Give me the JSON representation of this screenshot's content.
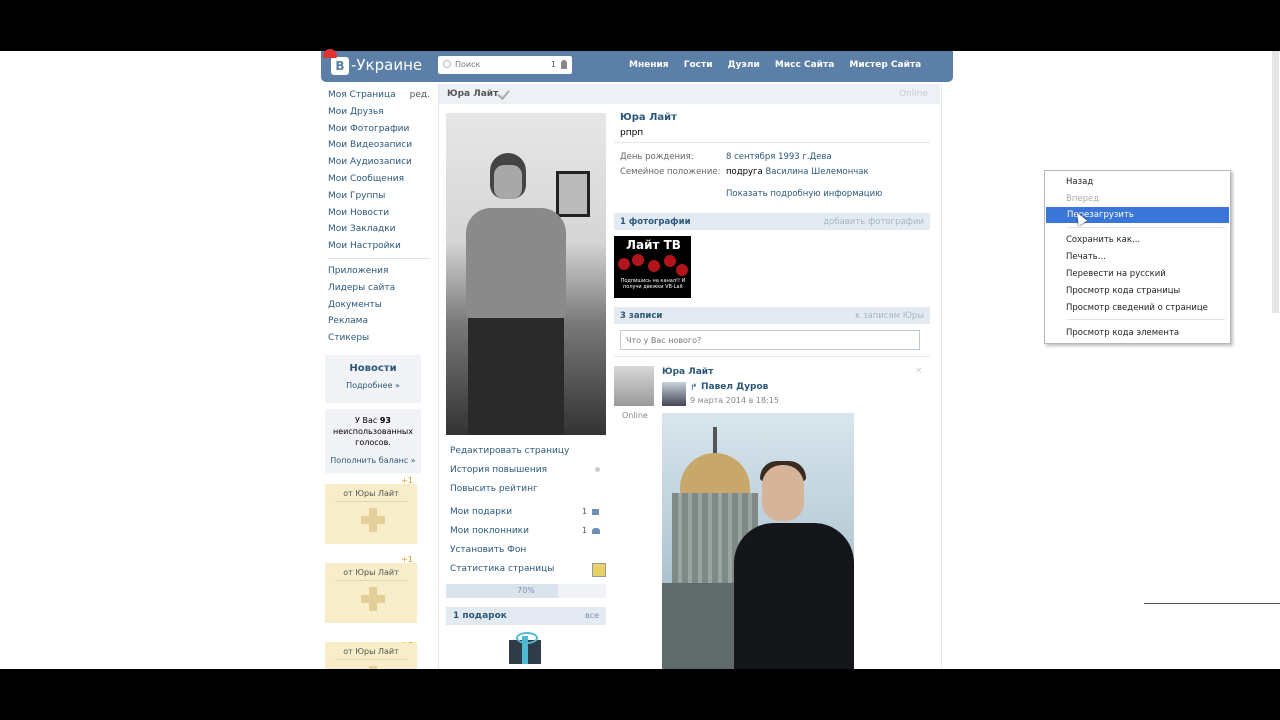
{
  "header": {
    "logo_letter": "В",
    "logo_text": "-Украине",
    "search_placeholder": "Поиск",
    "search_count": "1",
    "nav": [
      "Мнения",
      "Гости",
      "Дуэли",
      "Мисс Сайта",
      "Мистер Сайта"
    ]
  },
  "sidebar": {
    "items": [
      "Моя Страница",
      "Мои Друзья",
      "Мои Фотографии",
      "Мои Видеозаписи",
      "Мои Аудиозаписи",
      "Мои Сообщения",
      "Мои Группы",
      "Мои Новости",
      "Мои Закладки",
      "Мои Настройки"
    ],
    "edit": "ред.",
    "items2": [
      "Приложения",
      "Лидеры сайта",
      "Документы",
      "Реклама",
      "Стикеры"
    ],
    "news_title": "Новости",
    "news_more": "Подробнее »",
    "votes_line1": "У Вас",
    "votes_count": "93",
    "votes_line2": "неиспользованных голосов.",
    "votes_link": "Пополнить баланс »",
    "gift_plus": "+1",
    "gift_from": "от Юры Лайт"
  },
  "profile": {
    "bar_name": "Юра Лайт",
    "bar_status": "Online",
    "name": "Юра Лайт",
    "status": "рпрп",
    "birthday_label": "День рождения:",
    "birthday_value": "8 сентября 1993 г.",
    "zodiac": "Дева",
    "marital_label": "Семейное положение:",
    "marital_prefix": "подруга",
    "marital_partner": "Василина Шелемончак",
    "more_info": "Показать подробную информацию"
  },
  "actions": {
    "edit": "Редактировать страницу",
    "history": "История повышения",
    "rating": "Повысить рейтинг",
    "gifts": "Мои подарки",
    "gifts_count": "1",
    "fans": "Мои поклонники",
    "fans_count": "1",
    "background": "Установить Фон",
    "stats": "Статистика страницы",
    "progress_label": "70%",
    "progress_value": 0.7,
    "gifts_head": "1 подарок",
    "gifts_all": "все"
  },
  "photos": {
    "title": "1 фотографии",
    "add": "добавить фотографии",
    "thumb_title": "Лайт ТВ",
    "thumb_sub": "Подпишись на канал!! И получи двежки VB-Lait"
  },
  "wall": {
    "title": "3 записи",
    "link": "к записям Юры",
    "input_placeholder": "Что у Вас нового?",
    "post_author": "Юра Лайт",
    "post_online": "Online",
    "post_close": "×",
    "repost_arrow": "↱",
    "repost_author": "Павел Дуров",
    "post_date": "9 марта 2014 в 18:15"
  },
  "context_menu": {
    "back": "Назад",
    "forward": "Вперед",
    "reload": "Перезагрузить",
    "save": "Сохранить как...",
    "print": "Печать...",
    "translate": "Перевести на русский",
    "view_source": "Просмотр кода страницы",
    "page_info": "Просмотр  сведений о странице",
    "inspect": "Просмотр кода элемента"
  },
  "colors": {
    "header_blue": "#5b7fa6",
    "link_blue": "#2b587a",
    "menu_highlight": "#3a76d8",
    "gift_card_bg": "#f7edc9"
  }
}
